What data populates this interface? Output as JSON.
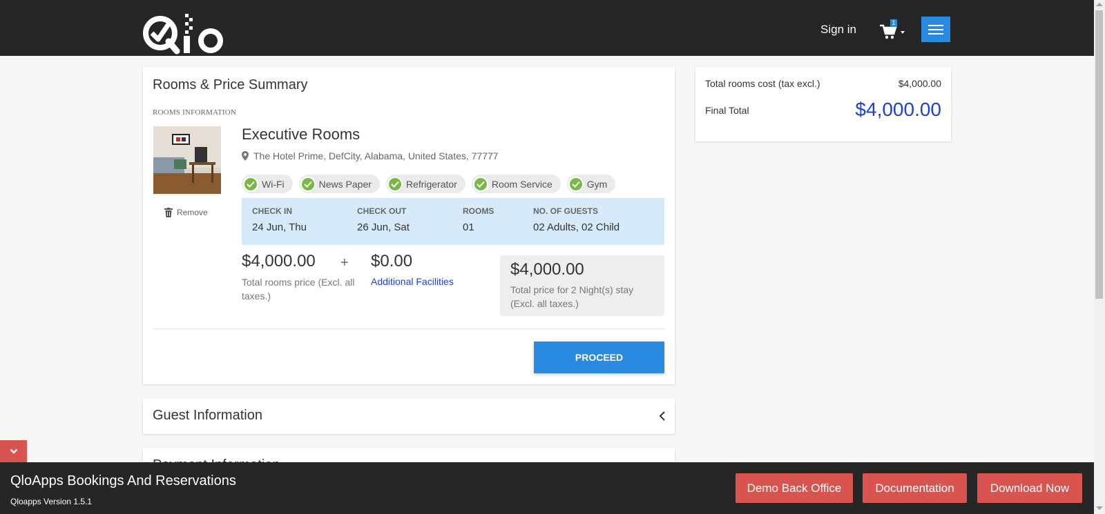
{
  "header": {
    "logo_text": "Qlo",
    "signin_label": "Sign in",
    "cart_count": "1",
    "cart_icon": "shopping-cart-icon",
    "menu_icon": "hamburger-menu-icon",
    "accent_color": "#2a8ae0"
  },
  "summary": {
    "title": "Rooms & Price Summary",
    "section_label": "ROOMS INFORMATION",
    "room": {
      "name": "Executive Rooms",
      "address": "The Hotel Prime, DefCity, Alabama, United States, 77777",
      "remove_label": "Remove",
      "features": [
        "Wi-Fi",
        "News Paper",
        "Refrigerator",
        "Room Service",
        "Gym"
      ],
      "booking": {
        "checkin_label": "CHECK IN",
        "checkin_value": "24 Jun, Thu",
        "checkout_label": "CHECK OUT",
        "checkout_value": "26 Jun, Sat",
        "rooms_label": "ROOMS",
        "rooms_value": "01",
        "guests_label": "NO. OF GUESTS",
        "guests_value": "02 Adults, 02 Child"
      },
      "room_price": "$4,000.00",
      "room_price_label": "Total rooms price (Excl. all taxes.)",
      "plus": "+",
      "extra_price": "$0.00",
      "extra_link": "Additional Facilities",
      "total_price": "$4,000.00",
      "total_note": "Total price for 2 Night(s) stay (Excl. all taxes.)"
    },
    "proceed_label": "PROCEED"
  },
  "guest": {
    "title": "Guest Information"
  },
  "payment": {
    "title": "Payment Information"
  },
  "cost": {
    "rooms_cost_label": "Total rooms cost (tax excl.)",
    "rooms_cost_value": "$4,000.00",
    "final_label": "Final Total",
    "final_value": "$4,000.00",
    "final_color": "#1c3fd6"
  },
  "footer": {
    "title": "QloApps Bookings And Reservations",
    "version": "Qloapps Version 1.5.1",
    "buttons": [
      "Demo Back Office",
      "Documentation",
      "Download Now"
    ],
    "button_color": "#d9534f"
  }
}
